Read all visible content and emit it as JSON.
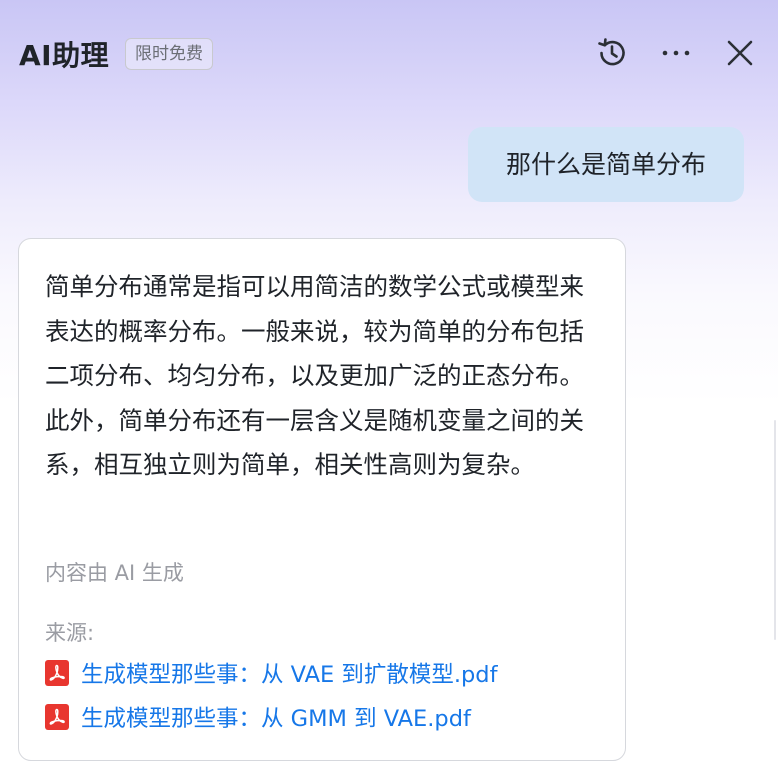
{
  "header": {
    "title": "AI助理",
    "badge": "限时免费",
    "icons": [
      "history-icon",
      "more-icon",
      "close-icon"
    ]
  },
  "chat": {
    "user_message": "那什么是简单分布",
    "answer": {
      "text": "简单分布通常是指可以用简洁的数学公式或模型来表达的概率分布。一般来说，较为简单的分布包括二项分布、均匀分布，以及更加广泛的正态分布。此外，简单分布还有一层含义是随机变量之间的关系，相互独立则为简单，相关性高则为复杂。",
      "ai_note": "内容由 AI 生成",
      "sources_label": "来源:",
      "sources": [
        {
          "title": "生成模型那些事：从 VAE 到扩散模型.pdf",
          "icon": "pdf-icon"
        },
        {
          "title": "生成模型那些事：从 GMM 到 VAE.pdf",
          "icon": "pdf-icon"
        }
      ]
    }
  },
  "colors": {
    "link": "#1677e8",
    "user_bubble": "#d1e4f7",
    "pdf_red": "#e8362f",
    "muted_text": "#9a9ca3"
  }
}
